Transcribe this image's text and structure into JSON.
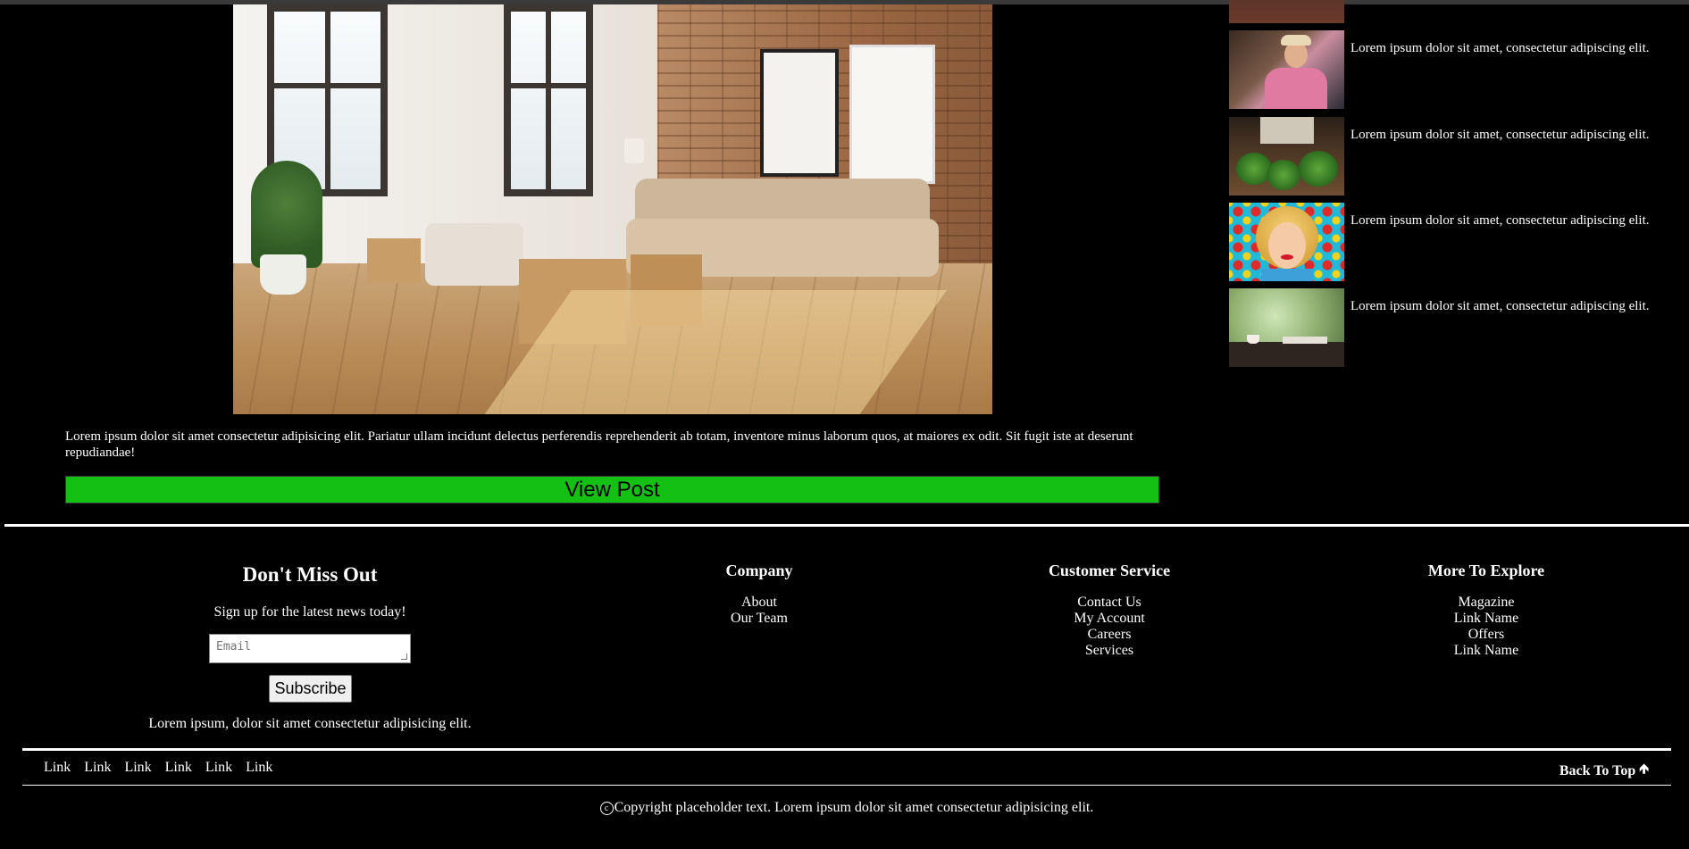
{
  "post": {
    "image_alt": "Sunny apartment living room with beige sofa, cardboard moving boxes and brick wall",
    "text": "Lorem ipsum dolor sit amet consectetur adipisicing elit. Pariatur ullam incidunt delectus perferendis reprehenderit ab totam, inventore minus laborum quos, at maiores ex odit. Sit fugit iste at deserunt repudiandae!",
    "button_label": "View Post",
    "button_color": "#13c013"
  },
  "sidebar": {
    "items": [
      {
        "text": "Lorem ipsum dolor sit amet, consectetur adipiscing elit."
      },
      {
        "text": "Lorem ipsum dolor sit amet, consectetur adipiscing elit."
      },
      {
        "text": "Lorem ipsum dolor sit amet, consectetur adipiscing elit."
      },
      {
        "text": "Lorem ipsum dolor sit amet, consectetur adipiscing elit."
      }
    ]
  },
  "newsletter": {
    "heading": "Don't Miss Out",
    "subheading": "Sign up for the latest news today!",
    "email_placeholder": "Email",
    "subscribe_label": "Subscribe",
    "note": "Lorem ipsum, dolor sit amet consectetur adipisicing elit."
  },
  "footer_columns": {
    "company": {
      "title": "Company",
      "links": [
        "About",
        "Our Team"
      ]
    },
    "service": {
      "title": "Customer Service",
      "links": [
        "Contact Us",
        "My Account",
        "Careers",
        "Services"
      ]
    },
    "explore": {
      "title": "More To Explore",
      "links": [
        "Magazine",
        "Link Name",
        "Offers",
        "Link Name"
      ]
    }
  },
  "bottom_bar": {
    "links": [
      "Link",
      "Link",
      "Link",
      "Link",
      "Link",
      "Link"
    ],
    "back_to_top": "Back To Top",
    "back_to_top_icon": "arrow-up-icon"
  },
  "copyright": {
    "icon": "copyright-icon",
    "text": "Copyright placeholder text. Lorem ipsum dolor sit amet consectetur adipisicing elit."
  }
}
